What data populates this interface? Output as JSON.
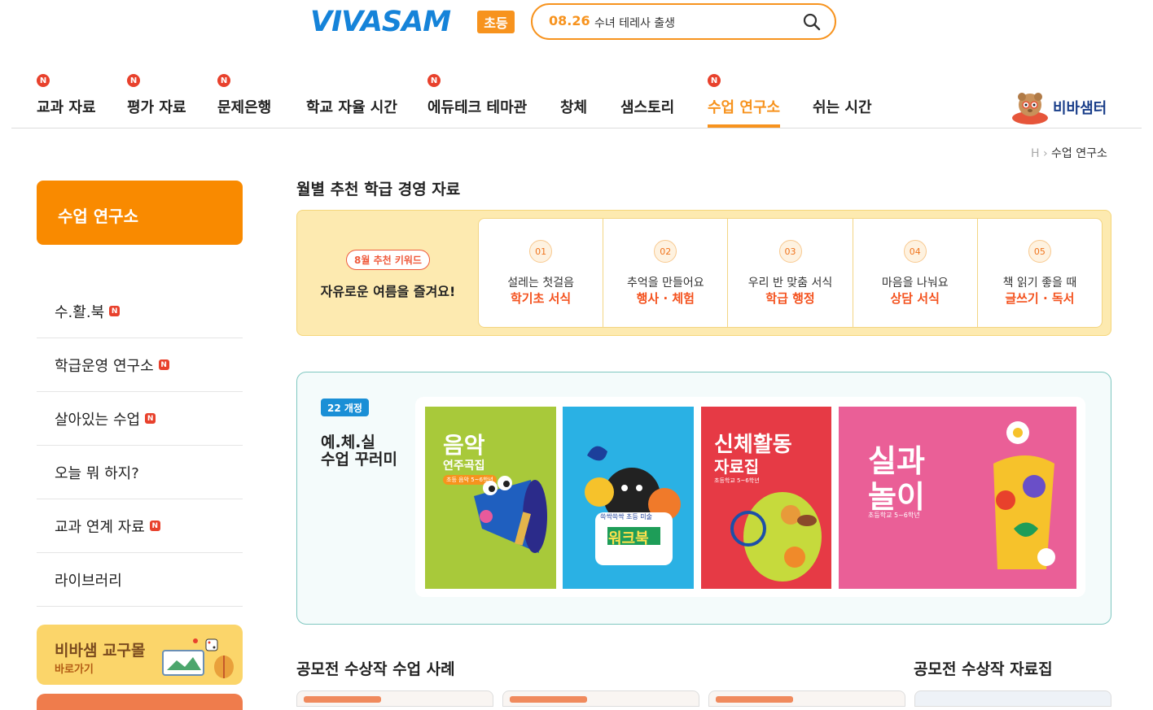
{
  "header": {
    "logo": "VIVASAM",
    "logo_badge": "초등",
    "search": {
      "date": "08.26",
      "text": "수녀 테레사 출생"
    }
  },
  "gnb": [
    {
      "label": "교과 자료",
      "new": true
    },
    {
      "label": "평가 자료",
      "new": true
    },
    {
      "label": "문제은행",
      "new": true
    },
    {
      "label": "학교 자율 시간",
      "new": false
    },
    {
      "label": "에듀테크 테마관",
      "new": true
    },
    {
      "label": "창체",
      "new": false
    },
    {
      "label": "샘스토리",
      "new": false
    },
    {
      "label": "수업 연구소",
      "new": true,
      "active": true
    },
    {
      "label": "쉬는 시간",
      "new": false
    }
  ],
  "new_mark": "N",
  "center_label": "비바샘터",
  "breadcrumb": {
    "home": "H",
    "current": "수업 연구소"
  },
  "sidebar": {
    "title": "수업 연구소",
    "items": [
      {
        "label": "수.활.북",
        "new": true
      },
      {
        "label": "학급운영 연구소",
        "new": true
      },
      {
        "label": "살아있는 수업",
        "new": true
      },
      {
        "label": "오늘 뭐 하지?",
        "new": false
      },
      {
        "label": "교과 연계 자료",
        "new": true
      },
      {
        "label": "라이브러리",
        "new": false
      }
    ],
    "banner": {
      "title": "비바샘 교구몰",
      "sub": "바로가기"
    }
  },
  "monthly": {
    "title": "월별 추천 학급 경영 자료",
    "keyword_badge": "8월 추천 키워드",
    "keyword_text": "자유로운 여름을 즐겨요!",
    "cards": [
      {
        "num": "01",
        "line1": "설레는 첫걸음",
        "line2": "학기초 서식"
      },
      {
        "num": "02",
        "line1": "추억을 만들어요",
        "line2": "행사 · 체험"
      },
      {
        "num": "03",
        "line1": "우리 반 맞춤 서식",
        "line2": "학급 행정"
      },
      {
        "num": "04",
        "line1": "마음을 나눠요",
        "line2": "상담 서식"
      },
      {
        "num": "05",
        "line1": "책 읽기 좋을 때",
        "line2": "글쓰기 · 독서"
      }
    ]
  },
  "arts": {
    "badge": "22 개정",
    "title_line1": "예.체.실",
    "title_line2": "수업 꾸러미",
    "books": [
      {
        "title": "음악",
        "sub": "연주곡집",
        "tag": "초등 음악 5~6학년",
        "color": "#a8c93a"
      },
      {
        "title": "워크북",
        "sub": "쓱싹쓱싹 초등 미술",
        "tag": "",
        "color": "#2ab1e4"
      },
      {
        "title": "신체활동",
        "sub": "자료집",
        "tag": "초등학교 5~6학년",
        "color": "#e63a45"
      },
      {
        "title": "실과",
        "sub": "놀이",
        "tag": "초등학교 5~6학년",
        "color": "#ea5f97"
      }
    ]
  },
  "bottom": {
    "award_title": "공모전 수상작 수업 사례",
    "award_book_title": "공모전 수상작 자료집"
  },
  "colors": {
    "brand_orange": "#f7931e",
    "sidebar_orange": "#f98a00",
    "new_red": "#e8412c",
    "logo_blue": "#1583d9"
  }
}
